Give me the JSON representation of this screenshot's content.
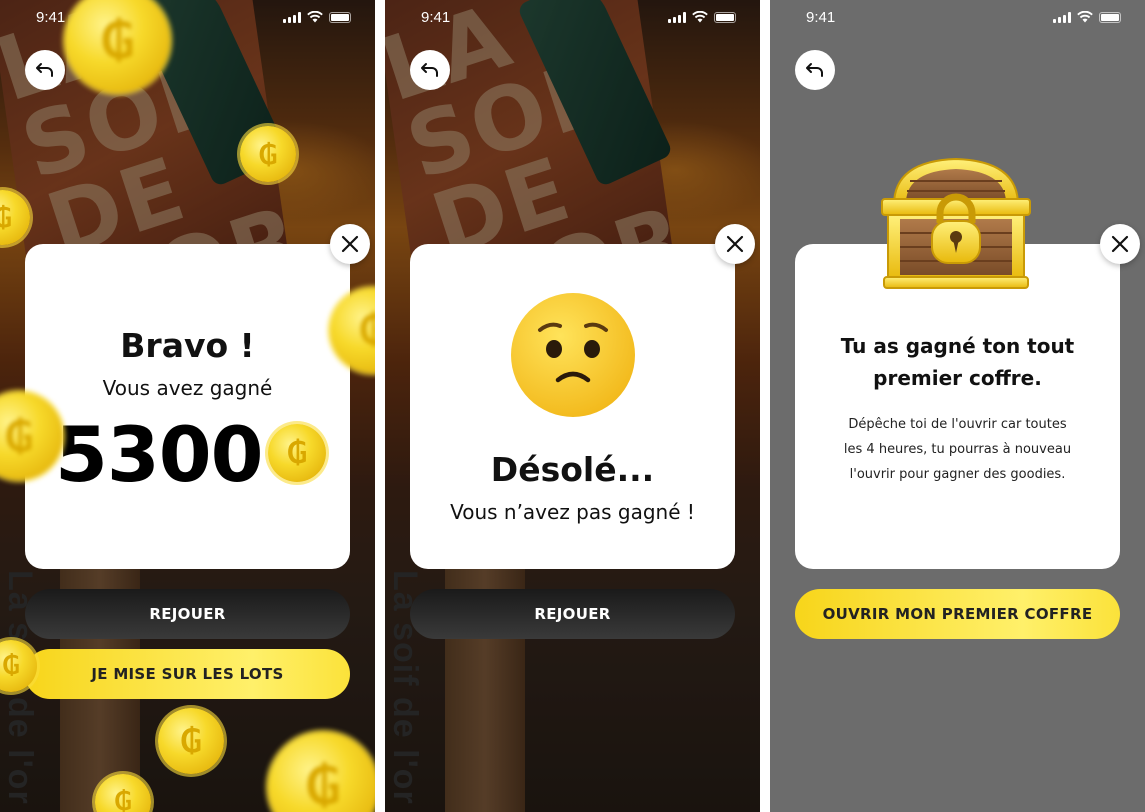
{
  "status_bar": {
    "time": "9:41"
  },
  "screens": [
    {
      "background_text": "La soif de l'or",
      "sign_text": "LA SOIF DE L'OR",
      "title": "Bravo !",
      "subtitle": "Vous avez gagné",
      "amount": "5300",
      "coin_symbol": "₲",
      "buttons": {
        "replay": "REJOUER",
        "bet": "JE MISE SUR LES LOTS"
      }
    },
    {
      "background_text": "La soif de l'or",
      "title": "Désolé...",
      "subtitle": "Vous n’avez pas gagné !",
      "emoji": "worried-face",
      "buttons": {
        "replay": "REJOUER"
      }
    },
    {
      "title_line1": "Tu as gagné ton tout",
      "title_line2": "premier coffre.",
      "body_line1": "Dépêche toi de l'ouvrir car toutes",
      "body_line2": "les 4 heures, tu pourras à nouveau",
      "body_line3": "l'ouvrir pour gagner des goodies.",
      "icon": "treasure-chest",
      "buttons": {
        "open": "OUVRIR MON PREMIER COFFRE"
      }
    }
  ],
  "colors": {
    "gold": "#f7d51a",
    "dark_button": "#2a2a2a",
    "grey_bg": "#6c6c6c"
  }
}
